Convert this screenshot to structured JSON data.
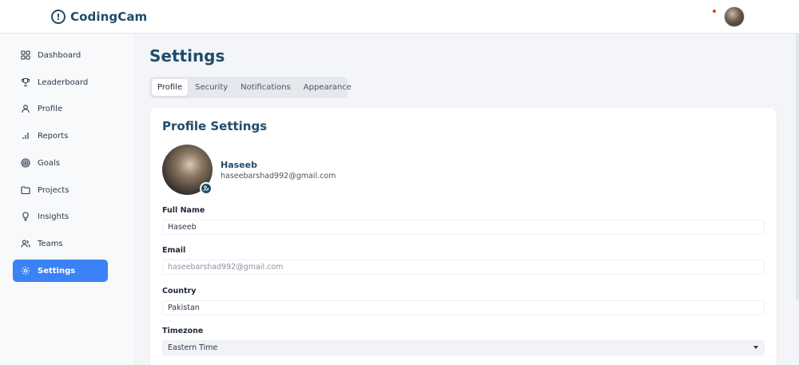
{
  "app": {
    "name": "CodingCam"
  },
  "sidebar": {
    "items": [
      {
        "label": "Dashboard",
        "icon": "grid-icon"
      },
      {
        "label": "Leaderboard",
        "icon": "trophy-icon"
      },
      {
        "label": "Profile",
        "icon": "user-icon"
      },
      {
        "label": "Reports",
        "icon": "bar-chart-icon"
      },
      {
        "label": "Goals",
        "icon": "target-icon"
      },
      {
        "label": "Projects",
        "icon": "folder-icon"
      },
      {
        "label": "Insights",
        "icon": "lightbulb-icon"
      },
      {
        "label": "Teams",
        "icon": "users-icon"
      },
      {
        "label": "Settings",
        "icon": "gear-icon",
        "active": true
      }
    ]
  },
  "page": {
    "title": "Settings",
    "tabs": [
      {
        "label": "Profile",
        "active": true
      },
      {
        "label": "Security"
      },
      {
        "label": "Notifications"
      },
      {
        "label": "Appearance"
      }
    ]
  },
  "profile_card": {
    "title": "Profile Settings",
    "name": "Haseeb",
    "email": "haseebarshad992@gmail.com",
    "fields": {
      "full_name": {
        "label": "Full Name",
        "value": "Haseeb"
      },
      "email": {
        "label": "Email",
        "placeholder": "haseebarshad992@gmail.com"
      },
      "country": {
        "label": "Country",
        "value": "Pakistan"
      },
      "timezone": {
        "label": "Timezone",
        "value": "Eastern Time"
      }
    }
  },
  "colors": {
    "brand": "#1f4d6b",
    "accent": "#3b82f6",
    "notification": "#d9480f"
  }
}
